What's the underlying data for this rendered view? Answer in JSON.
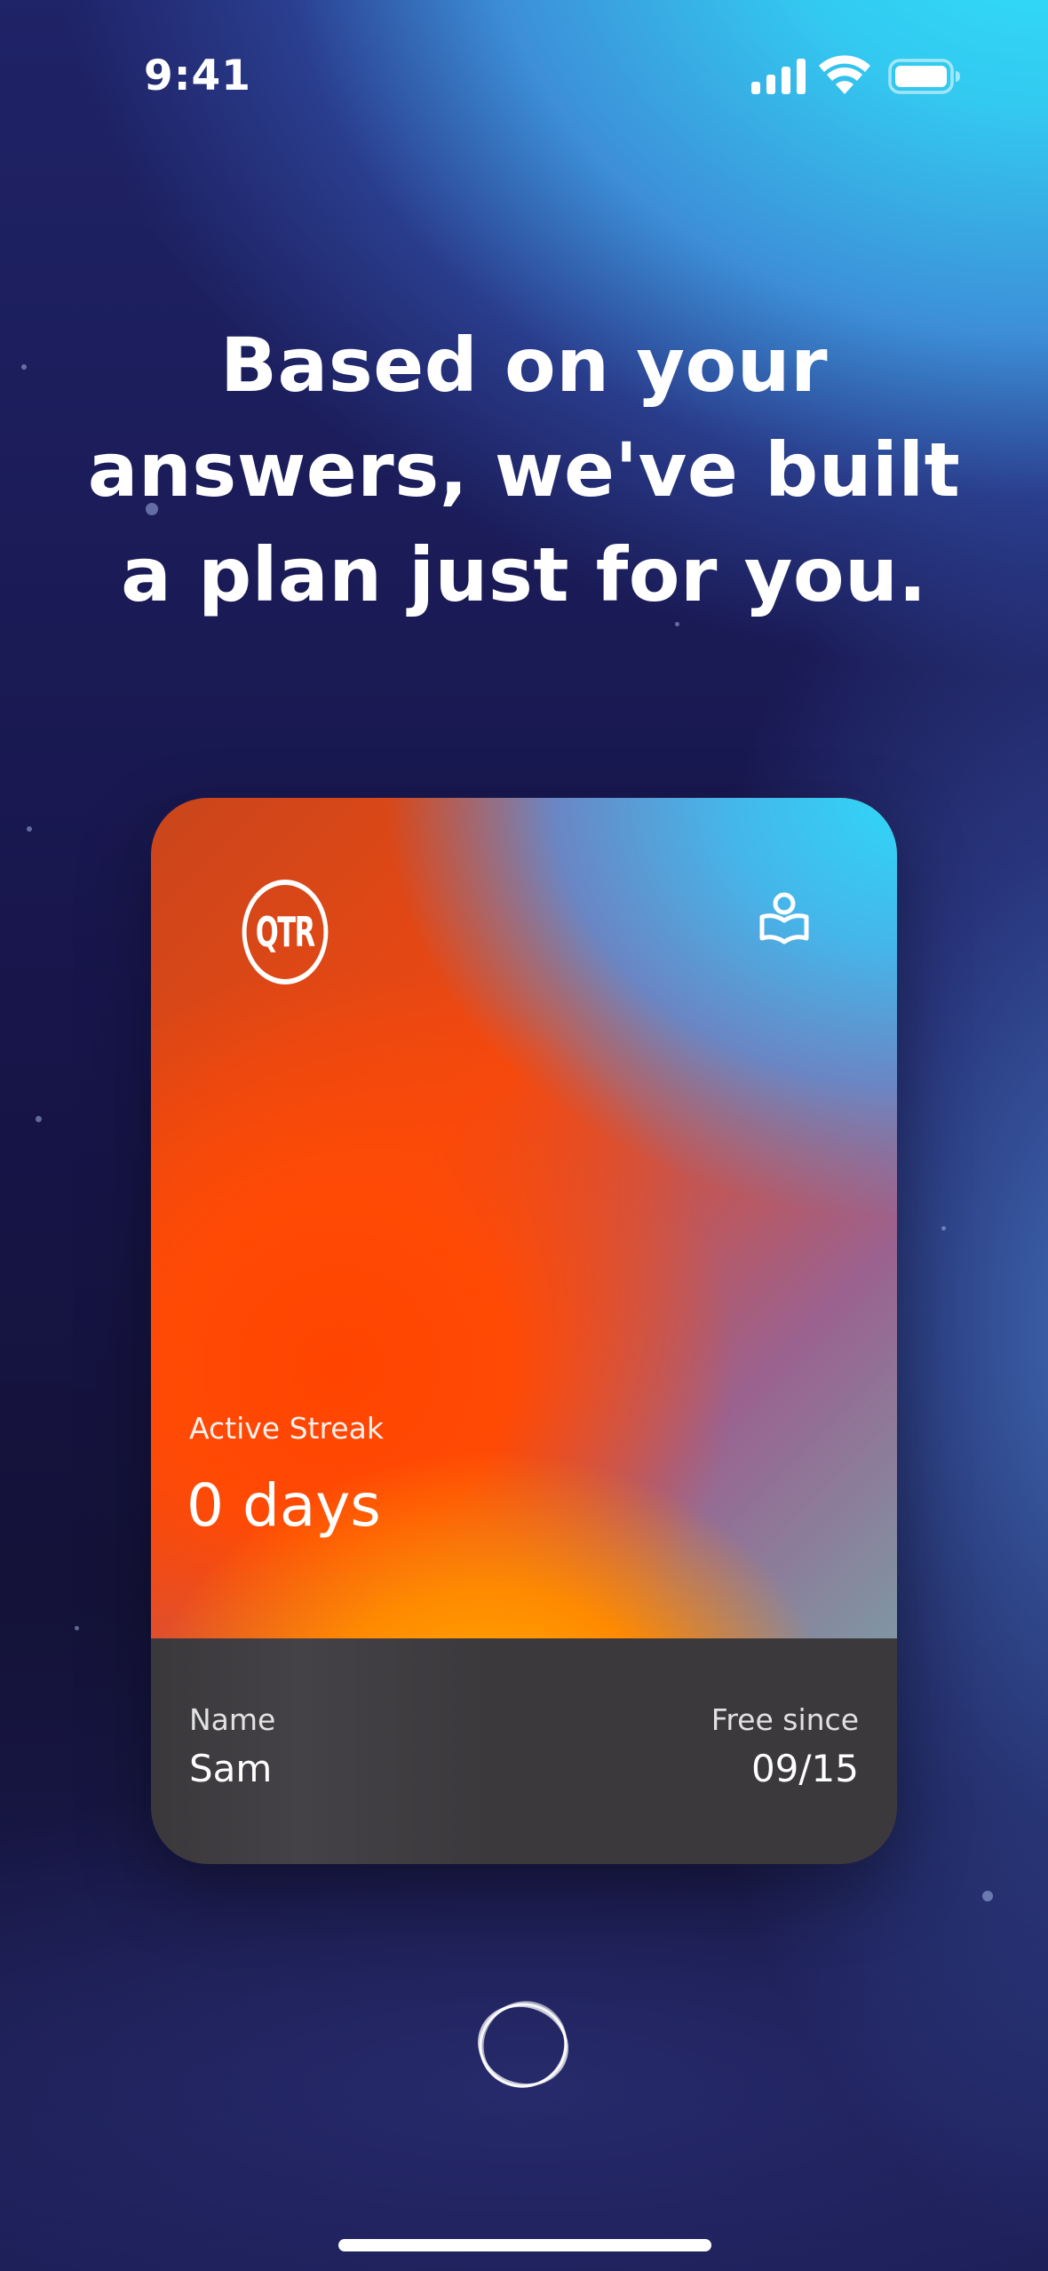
{
  "status_bar": {
    "time": "9:41",
    "icons": [
      "signal-icon",
      "wifi-icon",
      "battery-icon"
    ]
  },
  "headline": {
    "text": "Based on your answers, we've built a plan just for you."
  },
  "card": {
    "logo_text": "QTR",
    "top_right_icon": "reader-book-icon",
    "streak_label": "Active Streak",
    "streak_value": "0 days",
    "name_label": "Name",
    "name_value": "Sam",
    "since_label": "Free since",
    "since_value": "09/15"
  },
  "continue_button": {
    "icon": "orbit-circle-icon"
  },
  "colors": {
    "sky_cyan": "#2fe3fb",
    "space_navy": "#141238",
    "card_orange": "#ff4400",
    "card_amber": "#ffb000",
    "card_footer": "#3b393c",
    "text": "#ffffff"
  }
}
